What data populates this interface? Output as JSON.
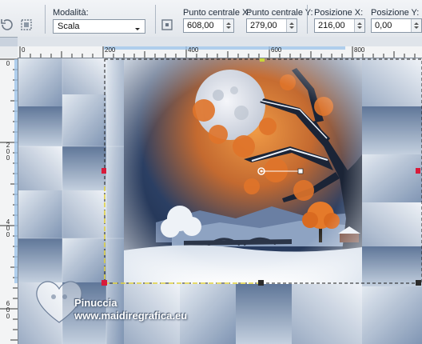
{
  "toolbar": {
    "mode_label": "Modalità:",
    "mode_value": "Scala",
    "center_x_label": "Punto centrale X:",
    "center_x_value": "608,00",
    "center_y_label": "Punto centrale Y:",
    "center_y_value": "279,00",
    "pos_x_label": "Posizione X:",
    "pos_x_value": "216,00",
    "pos_y_label": "Posizione Y:",
    "pos_y_value": "0,00"
  },
  "ruler_top": {
    "labels": [
      "0",
      "200",
      "400",
      "600",
      "800"
    ]
  },
  "ruler_left": {
    "labels": [
      "0",
      "200",
      "400",
      "600"
    ]
  },
  "watermark": {
    "line1": "Pinuccia",
    "line2": "www.maidiregrafica.eu"
  },
  "colors": {
    "selection_handle": "#d81b3a",
    "center_handle": "#c9d63a",
    "moon": "#dfe4ee",
    "sky_orange": "#e07a2c"
  },
  "icons": [
    "reset-icon",
    "pick-icon",
    "center-pick-icon",
    "up-down-arrows-icon",
    "chevron-down-icon"
  ]
}
